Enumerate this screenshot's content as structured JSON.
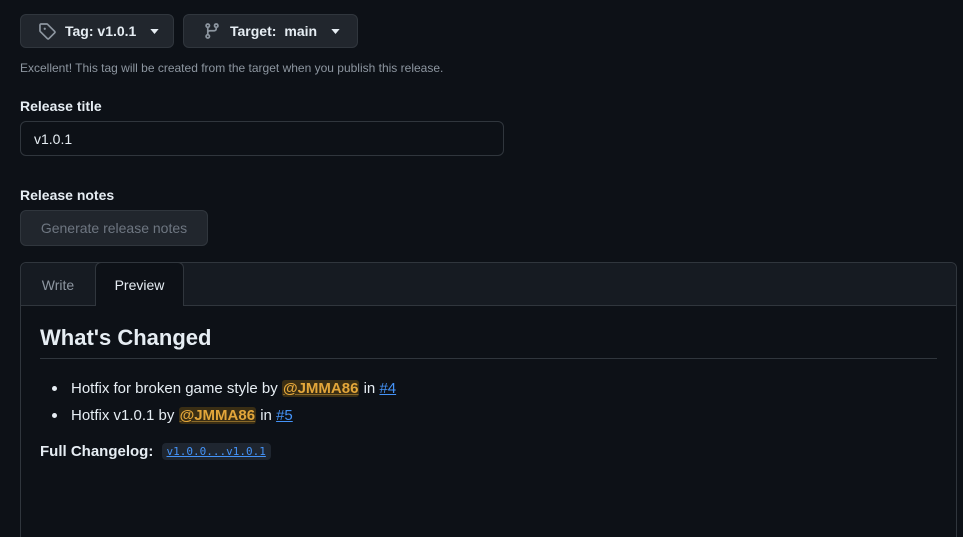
{
  "tag_picker": {
    "label": "Tag: v1.0.1",
    "icon": "tag-icon"
  },
  "target_picker": {
    "label": "Target:",
    "value": "main",
    "icon": "git-branch-icon"
  },
  "hint": "Excellent! This tag will be created from the target when you publish this release.",
  "release_title": {
    "label": "Release title",
    "value": "v1.0.1"
  },
  "release_notes": {
    "label": "Release notes",
    "generate_label": "Generate release notes"
  },
  "tabs": [
    {
      "label": "Write",
      "active": false
    },
    {
      "label": "Preview",
      "active": true
    }
  ],
  "preview": {
    "heading": "What's Changed",
    "changes": [
      {
        "text": "Hotfix for broken game style",
        "by": "by",
        "author": "@JMMA86",
        "in": "in",
        "pr": "#4"
      },
      {
        "text": "Hotfix v1.0.1",
        "by": "by",
        "author": "@JMMA86",
        "in": "in",
        "pr": "#5"
      }
    ],
    "full_changelog_label": "Full Changelog:",
    "full_changelog_link": "v1.0.0...v1.0.1"
  },
  "colors": {
    "background": "#0d1117",
    "border": "#30363d",
    "link": "#4493f8",
    "mention": "#e3a63a"
  }
}
